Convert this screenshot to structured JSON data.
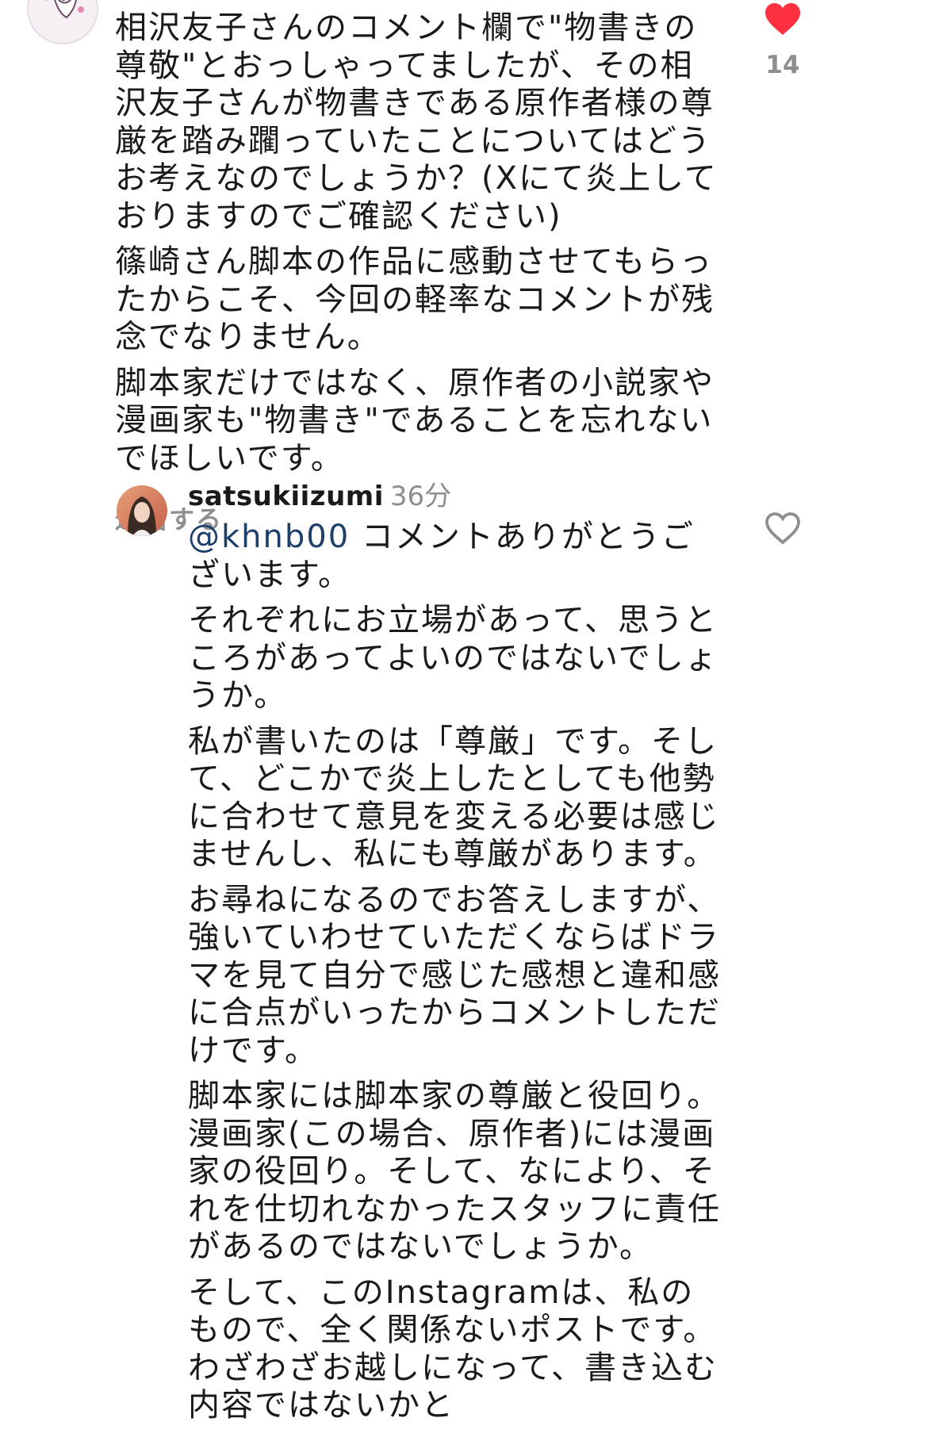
{
  "comment1": {
    "paragraphs": [
      "相沢友子さんのコメント欄で\"物書きの尊敬\"とおっしゃってましたが、その相沢友子さんが物書きである原作者様の尊厳を踏み躙っていたことについてはどうお考えなのでしょうか？(Xにて炎上しておりますのでご確認ください)",
      "篠崎さん脚本の作品に感動させてもらったからこそ、今回の軽率なコメントが残念でなりません。",
      "脚本家だけではなく、原作者の小説家や漫画家も\"物書き\"であることを忘れないでほしいです。"
    ],
    "reply_label": "返信する",
    "like_count": "14",
    "liked": true
  },
  "comment2": {
    "username": "satsukiizumi",
    "time": "36分",
    "mention": "@khnb00",
    "first_line_rest": " コメントありがとうございます。",
    "paragraphs": [
      "それぞれにお立場があって、思うところがあってよいのではないでしょうか。",
      "私が書いたのは「尊厳」です。そして、どこかで炎上したとしても他勢に合わせて意見を変える必要は感じませんし、私にも尊厳があります。",
      "お尋ねになるのでお答えしますが、強いていわせていただくならばドラマを見て自分で感じた感想と違和感に合点がいったからコメントしただけです。",
      "脚本家には脚本家の尊厳と役回り。漫画家(この場合、原作者)には漫画家の役回り。そして、なにより、それを仕切れなかったスタッフに責任があるのではないでしょうか。",
      "そして、このInstagramは、私のもので、全く関係ないポストです。わざわざお越しになって、書き込む内容ではないかと"
    ],
    "liked": false
  },
  "colors": {
    "like_red": "#ff3040",
    "muted": "#8e8e8e",
    "mention": "#1f3f6b"
  }
}
